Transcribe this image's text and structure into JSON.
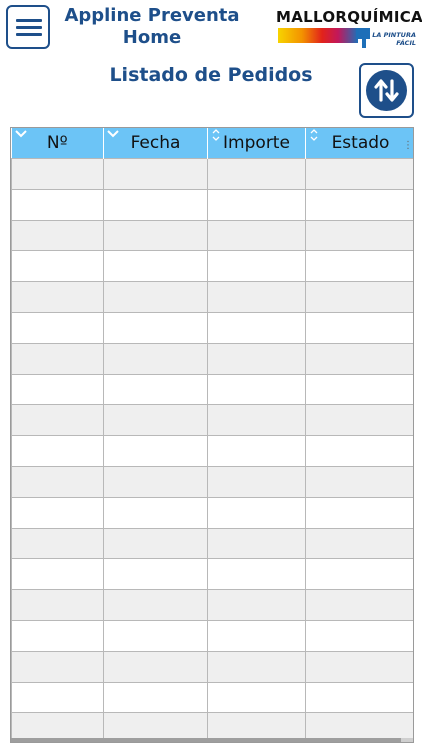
{
  "header": {
    "app_title_line1": "Appline Preventa",
    "app_title_line2": "Home",
    "logo_name": "MALLORQUÍMICA",
    "logo_tagline": "LA PINTURA FÁCIL"
  },
  "page_title": "Listado de Pedidos",
  "table": {
    "columns": [
      {
        "label": "Nº",
        "sort_icon": "chevron-down-icon"
      },
      {
        "label": "Fecha",
        "sort_icon": "chevron-down-icon"
      },
      {
        "label": "Importe",
        "sort_icon": "sort-updown-icon"
      },
      {
        "label": "Estado",
        "sort_icon": "sort-updown-icon"
      }
    ],
    "empty_rows": 19
  },
  "icons": {
    "menu": "hamburger-menu-icon",
    "sort": "sort-arrows-icon"
  },
  "colors": {
    "brand_blue": "#1e4f8a",
    "header_blue": "#6cc4f6"
  }
}
